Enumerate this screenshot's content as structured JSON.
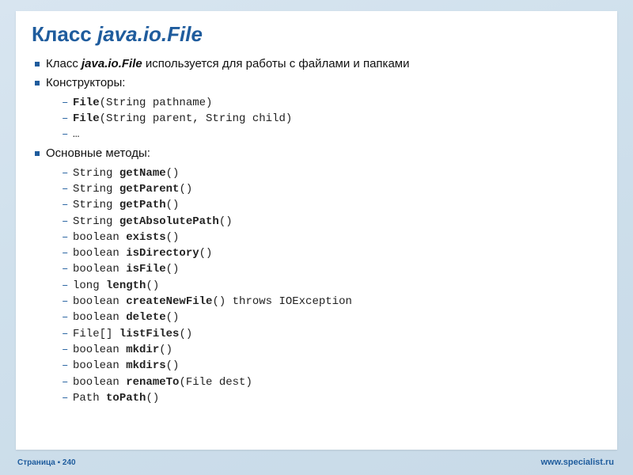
{
  "title_prefix": "Класс ",
  "title_class": "java.io.File",
  "bullets": {
    "desc_prefix": "Класс ",
    "desc_class": "java.io.File",
    "desc_suffix": " используется для работы с файлами и папками",
    "ctors_label": "Конструкторы:",
    "ctors": [
      {
        "b": "File",
        "rest": "(String pathname)"
      },
      {
        "b": "File",
        "rest": "(String parent, String child)"
      },
      {
        "b": "",
        "rest": "…"
      }
    ],
    "methods_label": "Основные методы:",
    "methods": [
      {
        "pre": "String ",
        "b": "getName",
        "post": "()"
      },
      {
        "pre": "String ",
        "b": "getParent",
        "post": "()"
      },
      {
        "pre": "String ",
        "b": "getPath",
        "post": "()"
      },
      {
        "pre": "String ",
        "b": "getAbsolutePath",
        "post": "()"
      },
      {
        "pre": "boolean ",
        "b": "exists",
        "post": "()"
      },
      {
        "pre": "boolean ",
        "b": "isDirectory",
        "post": "()"
      },
      {
        "pre": "boolean ",
        "b": "isFile",
        "post": "()"
      },
      {
        "pre": "long ",
        "b": "length",
        "post": "()"
      },
      {
        "pre": "boolean ",
        "b": "createNewFile",
        "post": "() throws IOException"
      },
      {
        "pre": "boolean ",
        "b": "delete",
        "post": "()"
      },
      {
        "pre": "File[] ",
        "b": "listFiles",
        "post": "()"
      },
      {
        "pre": "boolean ",
        "b": "mkdir",
        "post": "()"
      },
      {
        "pre": "boolean ",
        "b": "mkdirs",
        "post": "()"
      },
      {
        "pre": "boolean ",
        "b": "renameTo",
        "post": "(File dest)"
      },
      {
        "pre": "Path ",
        "b": "toPath",
        "post": "()"
      }
    ]
  },
  "footer": {
    "page_label": "Страница",
    "sep": " ▪ ",
    "num": "240"
  },
  "site": "www.specialist.ru"
}
